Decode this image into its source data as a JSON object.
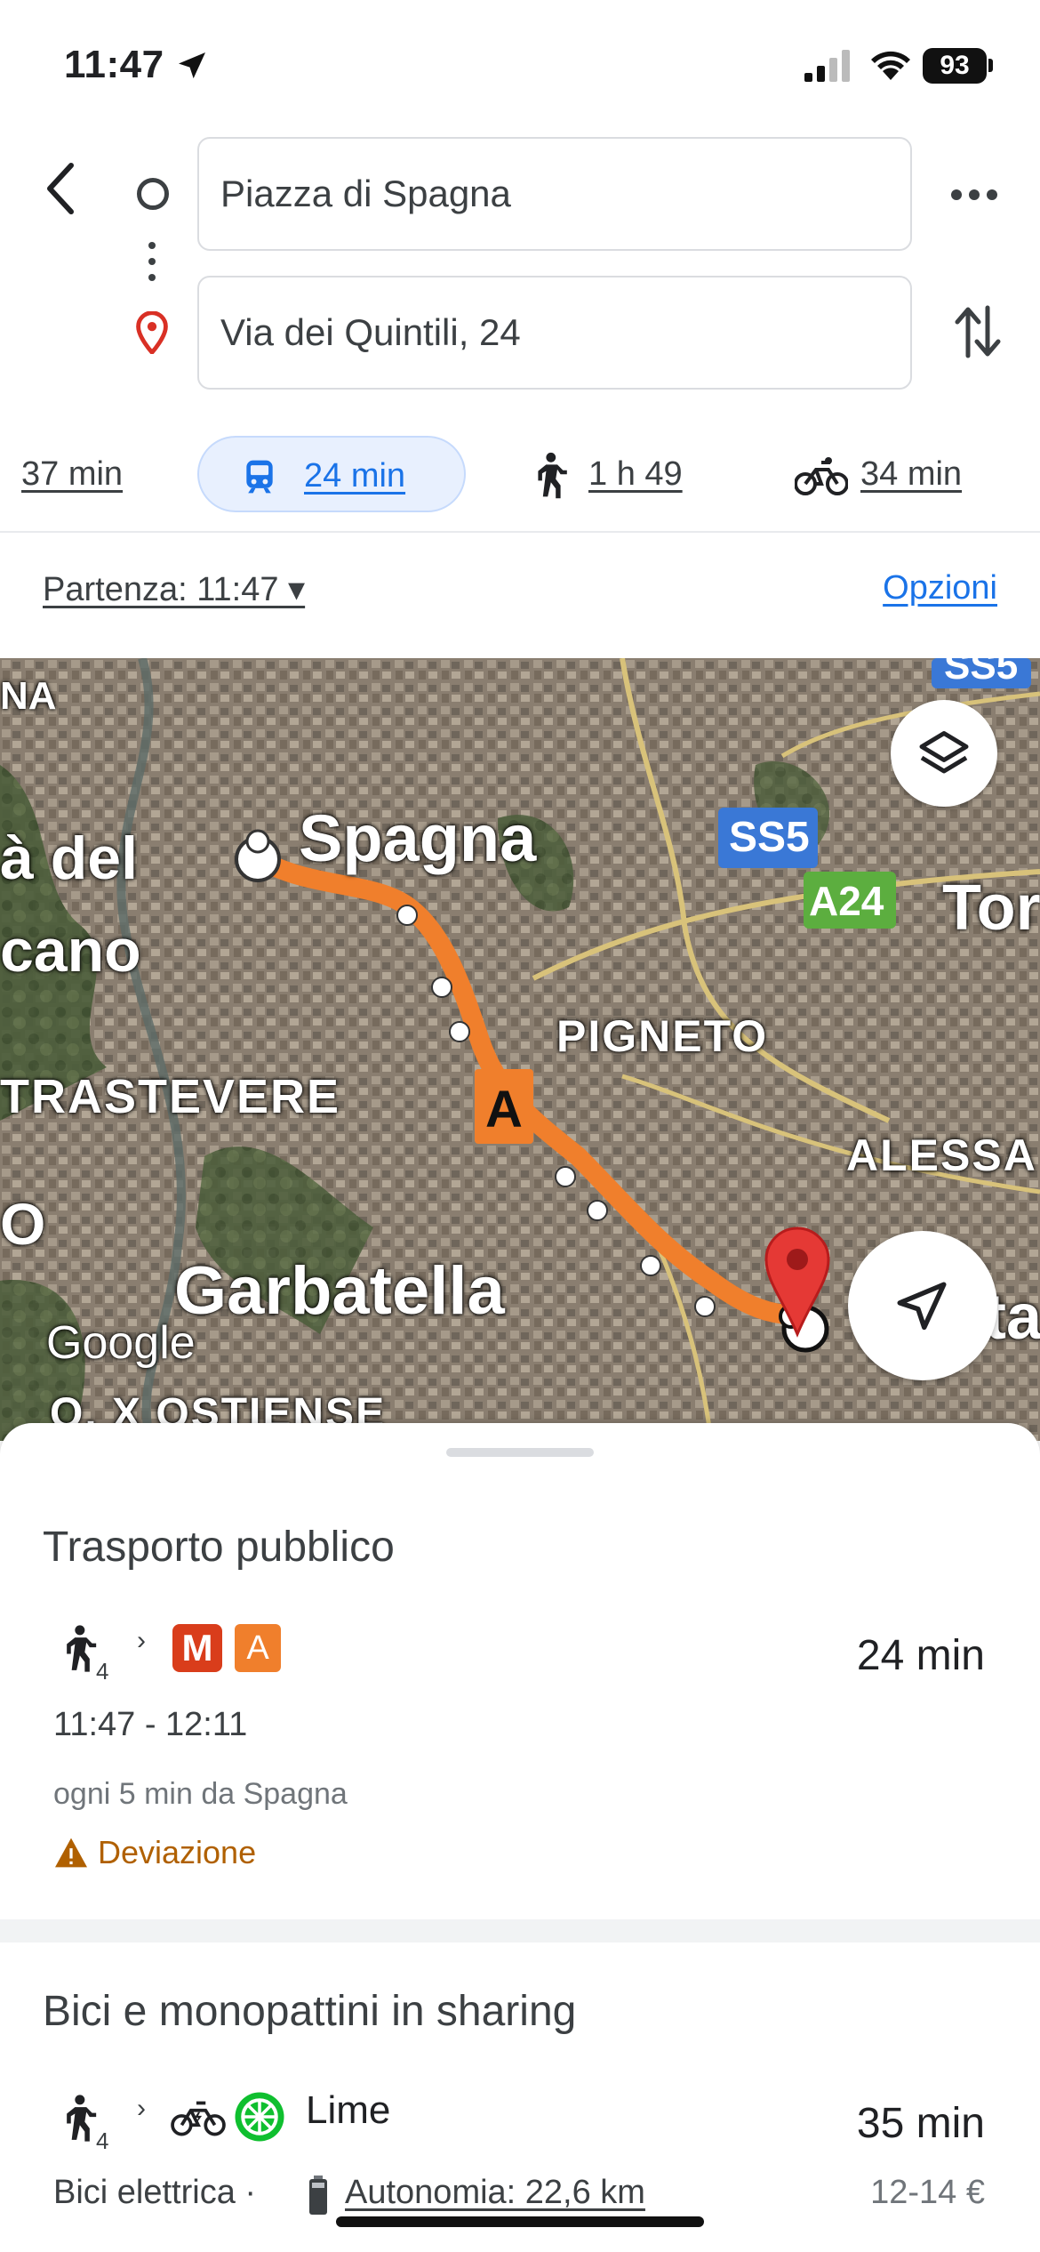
{
  "status_bar": {
    "time": "11:47",
    "battery": "93"
  },
  "search": {
    "origin": "Piazza di Spagna",
    "destination": "Via dei Quintili, 24"
  },
  "modes": [
    {
      "name": "car",
      "label": "37 min"
    },
    {
      "name": "transit",
      "label": "24 min",
      "selected": true
    },
    {
      "name": "walk",
      "label": "1 h 49"
    },
    {
      "name": "bike",
      "label": "34 min"
    }
  ],
  "departure": {
    "label": "Partenza: 11:47",
    "options": "Opzioni"
  },
  "map": {
    "labels": {
      "spagna": "Spagna",
      "citta1": "à del",
      "citta2": "cano",
      "na": "NA",
      "trastevere": "TRASTEVERE",
      "pigneto": "PIGNETO",
      "alessa": "ALESSA",
      "garbatella": "Garbatella",
      "tor": "Tor",
      "ta": "ta",
      "o": "O",
      "ostiense": "Q. X OSTIENSE",
      "google": "Google"
    },
    "shields": {
      "ss5": "SS5",
      "a24": "A24",
      "ss5_top": "SS5"
    },
    "line_marker": "A",
    "accent_route": "#f07f2c"
  },
  "transit": {
    "title": "Trasporto pubblico",
    "walk_minutes": "4",
    "metro_badge": "M",
    "line_badge": "A",
    "duration": "24 min",
    "times": "11:47 - 12:11",
    "frequency": "ogni 5 min da Spagna",
    "alert": "Deviazione"
  },
  "sharing": {
    "title": "Bici e monopattini in sharing",
    "walk_minutes": "4",
    "provider": "Lime",
    "duration": "35 min",
    "vehicle": "Bici elettrica ·",
    "range": "Autonomia: 22,6 km",
    "price": "12-14 €"
  }
}
